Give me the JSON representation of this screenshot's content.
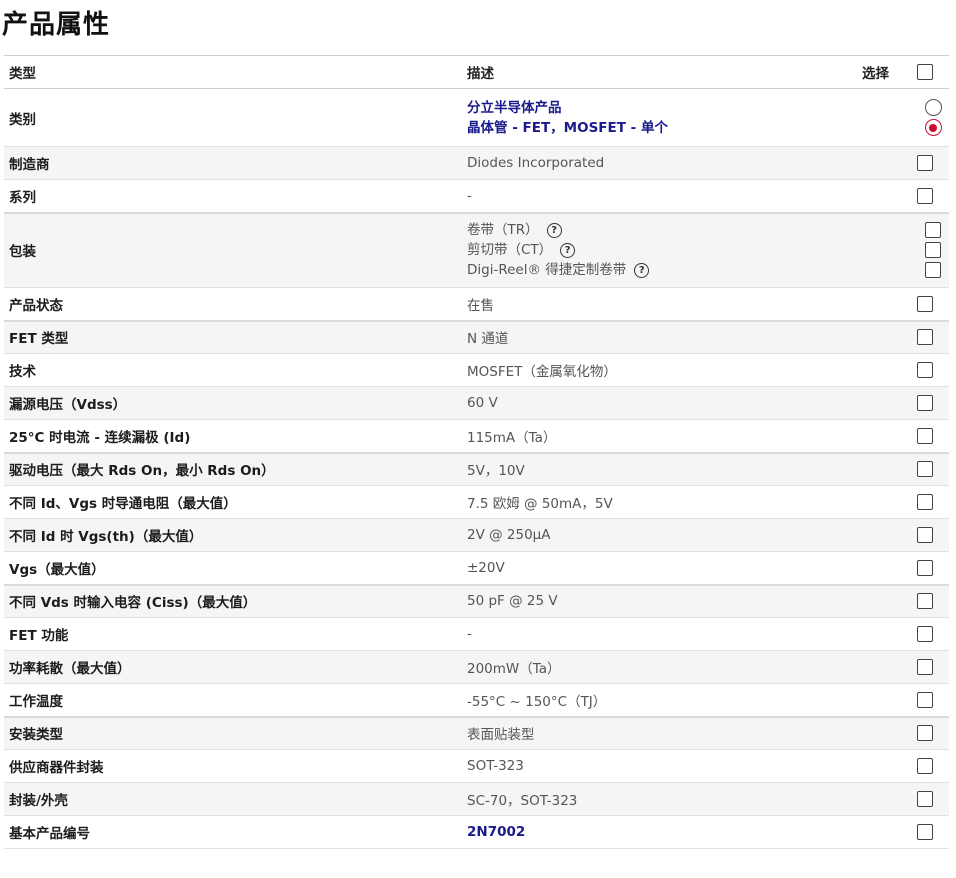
{
  "title": "产品属性",
  "headers": {
    "type": "类型",
    "desc": "描述",
    "select": "选择"
  },
  "category": {
    "label": "类别",
    "line1": "分立半导体产品",
    "line2": "晶体管 - FET，MOSFET - 单个"
  },
  "packaging": {
    "label": "包装",
    "options": [
      {
        "text": "卷带（TR）",
        "help": "?"
      },
      {
        "text": "剪切带（CT）",
        "help": "?"
      },
      {
        "text": "Digi-Reel® 得捷定制卷带",
        "help": "?"
      }
    ]
  },
  "rows": [
    {
      "label": "制造商",
      "value": "Diodes Incorporated"
    },
    {
      "label": "系列",
      "value": "-"
    },
    {
      "label": "产品状态",
      "value": "在售"
    },
    {
      "label": "FET 类型",
      "value": "N 通道"
    },
    {
      "label": "技术",
      "value": "MOSFET（金属氧化物）"
    },
    {
      "label": "漏源电压（Vdss）",
      "value": "60 V"
    },
    {
      "label": "25°C 时电流 - 连续漏极 (Id)",
      "value": "115mA（Ta）"
    },
    {
      "label": "驱动电压（最大 Rds On，最小 Rds On）",
      "value": "5V，10V"
    },
    {
      "label": "不同 Id、Vgs 时导通电阻（最大值）",
      "value": "7.5 欧姆 @ 50mA，5V"
    },
    {
      "label": "不同 Id 时 Vgs(th)（最大值）",
      "value": "2V @ 250µA"
    },
    {
      "label": "Vgs（最大值）",
      "value": "±20V"
    },
    {
      "label": "不同 Vds 时输入电容 (Ciss)（最大值）",
      "value": "50 pF @ 25 V"
    },
    {
      "label": "FET 功能",
      "value": "-"
    },
    {
      "label": "功率耗散（最大值）",
      "value": "200mW（Ta）"
    },
    {
      "label": "工作温度",
      "value": "-55°C ~ 150°C（TJ）"
    },
    {
      "label": "安装类型",
      "value": "表面贴装型"
    },
    {
      "label": "供应商器件封装",
      "value": "SOT-323"
    },
    {
      "label": "封装/外壳",
      "value": "SC-70，SOT-323"
    },
    {
      "label": "基本产品编号",
      "value": "2N7002"
    }
  ],
  "colors": {
    "link": "#1a1a8c",
    "radio_selected": "#c8102e",
    "row_alt": "#f5f5f5"
  }
}
